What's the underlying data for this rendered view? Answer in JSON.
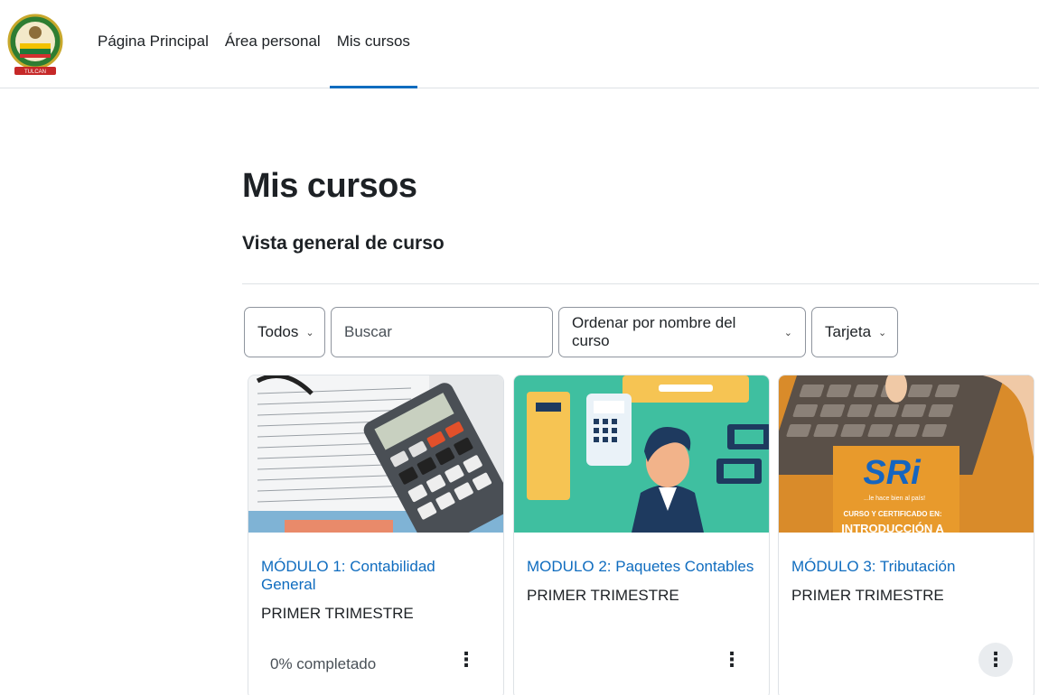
{
  "nav": {
    "items": [
      {
        "label": "Página Principal"
      },
      {
        "label": "Área personal"
      },
      {
        "label": "Mis cursos"
      }
    ],
    "active_index": 2
  },
  "page": {
    "title": "Mis cursos",
    "section_title": "Vista general de curso"
  },
  "filters": {
    "grouping": "Todos",
    "search_placeholder": "Buscar",
    "sort": "Ordenar por nombre del curso",
    "view": "Tarjeta"
  },
  "courses": [
    {
      "title": "MÓDULO 1: Contabilidad General",
      "category": "PRIMER TRIMESTRE",
      "progress": "0% completado"
    },
    {
      "title": "MODULO 2: Paquetes Contables",
      "category": "PRIMER TRIMESTRE"
    },
    {
      "title": "MÓDULO 3: Tributación",
      "category": "PRIMER TRIMESTRE"
    }
  ],
  "course_image_text": {
    "brand": "SRi",
    "tagline": "...le hace bien al país!",
    "line1": "CURSO Y CERTIFICADO EN:",
    "line2": "INTRODUCCIÓN A"
  },
  "logo_text": "TULCAN",
  "colors": {
    "link": "#0f6cbf",
    "active_tab": "#0f6cbf",
    "border": "#dee2e6"
  }
}
